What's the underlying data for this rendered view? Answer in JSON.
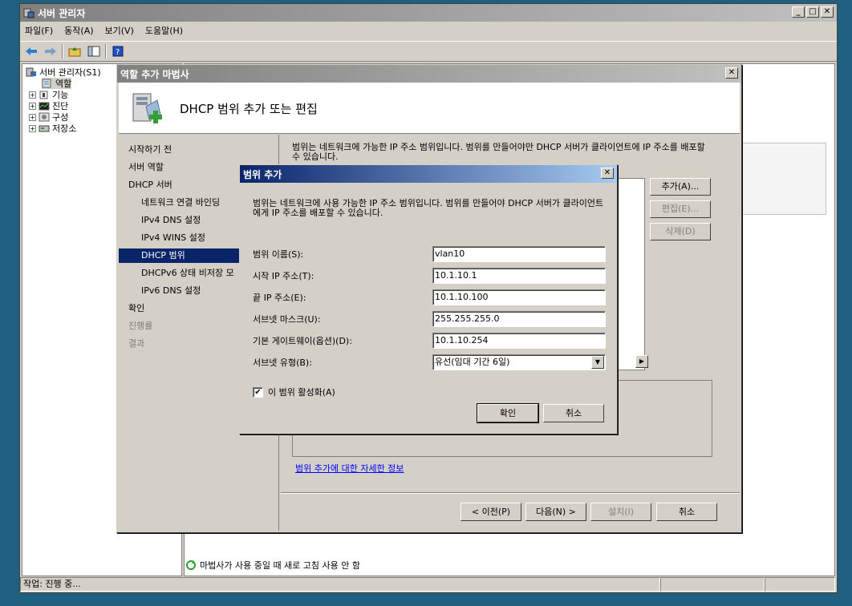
{
  "main_window": {
    "title": "서버 관리자",
    "menu": [
      "파일(F)",
      "동작(A)",
      "보기(V)",
      "도움말(H)"
    ],
    "tree": {
      "root": "서버 관리자(S1)",
      "items": [
        "역할",
        "기능",
        "진단",
        "구성",
        "저장소"
      ]
    },
    "notice": "마법사가 사용 중일 때 새로 고침 사용 안 함",
    "status": "작업: 진행 중..."
  },
  "wizard": {
    "title": "역할 추가 마법사",
    "header_title": "DHCP 범위 추가 또는 편집",
    "nav": [
      "시작하기 전",
      "서버 역할",
      "DHCP 서버",
      "네트워크 연결 바인딩",
      "IPv4 DNS 설정",
      "IPv4 WINS 설정",
      "DHCP 범위",
      "DHCPv6 상태 비저장 모",
      "IPv6 DNS 설정",
      "확인",
      "진행률",
      "결과"
    ],
    "description": "범위는 네트워크에 가능한 IP 주소 범위입니다. 범위를 만들어야만 DHCP 서버가 클라이언트에 IP 주소를 배포할 수 있습니다.",
    "side_buttons": {
      "add": "추가(A)...",
      "edit": "편집(E)...",
      "delete": "삭제(D)"
    },
    "link": "범위 추가에 대한 자세한 정보",
    "buttons": {
      "prev": "< 이전(P)",
      "next": "다음(N) >",
      "install": "설치(I)",
      "cancel": "취소"
    }
  },
  "dialog": {
    "title": "범위 추가",
    "description": "범위는 네트워크에 사용 가능한 IP 주소 범위입니다. 범위를 만들어야 DHCP 서버가 클라이언트에게 IP 주소를 배포할 수 있습니다.",
    "fields": {
      "scope_name": {
        "label": "범위 이름(S):",
        "value": "vlan10"
      },
      "start_ip": {
        "label": "시작 IP 주소(T):",
        "value": "10.1.10.1"
      },
      "end_ip": {
        "label": "끝 IP 주소(E):",
        "value": "10.1.10.100"
      },
      "subnet_mask": {
        "label": "서브넷 마스크(U):",
        "value": "255.255.255.0"
      },
      "gateway": {
        "label": "기본 게이트웨이(옵션)(D):",
        "value": "10.1.10.254"
      },
      "subnet_type": {
        "label": "서브넷 유형(B):",
        "value": "유선(임대 기간 6일)"
      }
    },
    "activate_label": "이 범위 활성화(A)",
    "ok": "확인",
    "cancel": "취소"
  }
}
